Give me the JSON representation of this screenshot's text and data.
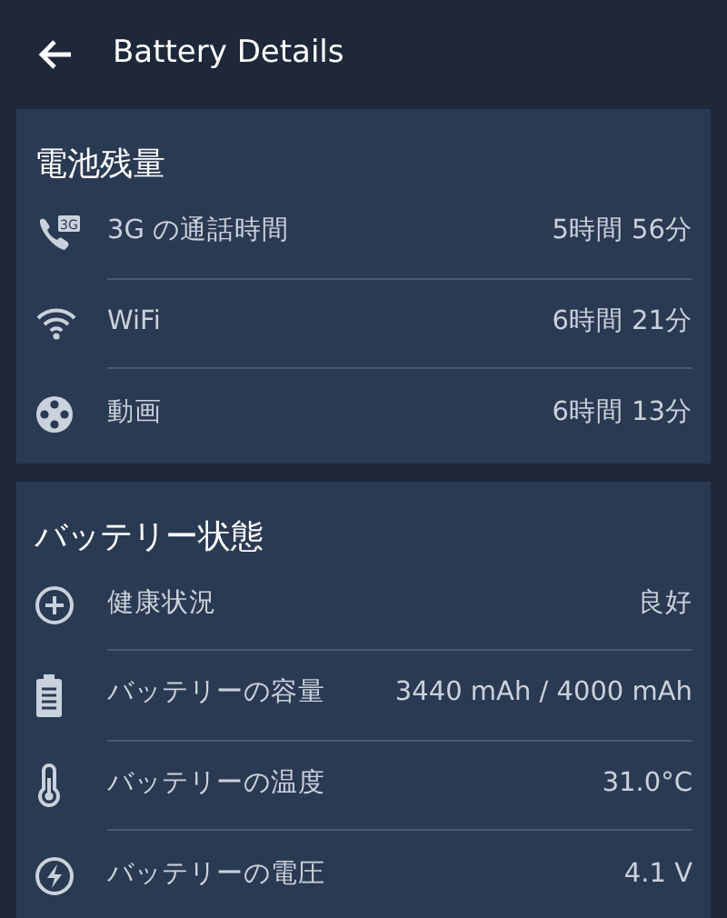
{
  "app_bar": {
    "title": "Battery Details"
  },
  "sections": [
    {
      "title": "電池残量",
      "rows": [
        {
          "label": "3G の通話時間",
          "value": "5時間 56分",
          "icon_badge": "3G"
        },
        {
          "label": "WiFi",
          "value": "6時間 21分"
        },
        {
          "label": "動画",
          "value": "6時間 13分"
        }
      ]
    },
    {
      "title": "バッテリー状態",
      "rows": [
        {
          "label": "健康状況",
          "value": "良好"
        },
        {
          "label": "バッテリーの容量",
          "value": "3440 mAh / 4000 mAh"
        },
        {
          "label": "バッテリーの温度",
          "value": "31.0°C"
        },
        {
          "label": "バッテリーの電圧",
          "value": "4.1 V"
        }
      ]
    }
  ]
}
